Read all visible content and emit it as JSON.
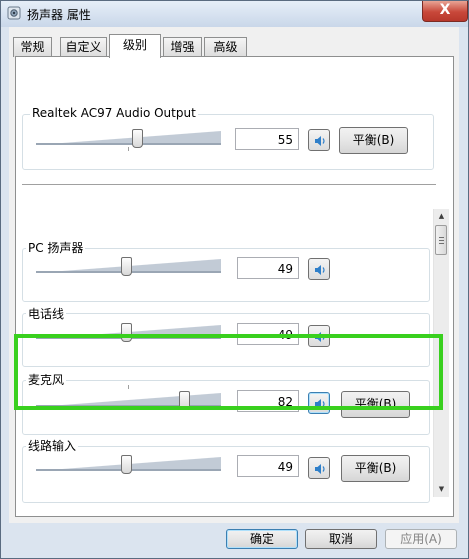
{
  "window": {
    "title": "扬声器 属性",
    "close_symbol": "X",
    "icon": "speaker-icon"
  },
  "tabs": [
    {
      "label": "常规",
      "active": false
    },
    {
      "label": "自定义",
      "active": false
    },
    {
      "label": "级别",
      "active": true
    },
    {
      "label": "增强",
      "active": false
    },
    {
      "label": "高级",
      "active": false
    }
  ],
  "main_output": {
    "label": "Realtek AC97 Audio Output",
    "level": 55,
    "value_text": "55",
    "balance_label": "平衡(B)"
  },
  "mixer": [
    {
      "label": "PC 扬声器",
      "level": 49,
      "value_text": "49",
      "has_balance": false,
      "balance_label": ""
    },
    {
      "label": "电话线",
      "level": 49,
      "value_text": "49",
      "has_balance": false,
      "balance_label": ""
    },
    {
      "label": "麦克风",
      "level": 82,
      "value_text": "82",
      "has_balance": true,
      "balance_label": "平衡(B)",
      "highlighted": true
    },
    {
      "label": "线路输入",
      "level": 49,
      "value_text": "49",
      "has_balance": true,
      "balance_label": "平衡(B)"
    }
  ],
  "footer": {
    "ok_label": "确定",
    "cancel_label": "取消",
    "apply_label": "应用(A)"
  },
  "colors": {
    "highlight_border": "#39d01e",
    "title_gradient_top": "#e6eef8",
    "close_button": "#c8483a"
  }
}
